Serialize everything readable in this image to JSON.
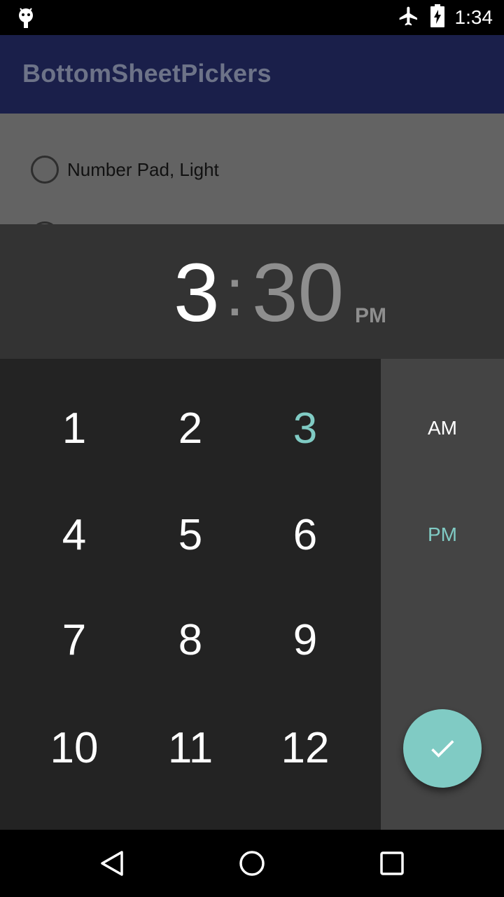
{
  "status_bar": {
    "time": "1:34",
    "icons": [
      "android-debug-icon",
      "airplane-mode-icon",
      "battery-charging-icon"
    ]
  },
  "app_bar": {
    "title": "BottomSheetPickers"
  },
  "options": [
    {
      "label": "Number Pad, Light",
      "selected": false
    }
  ],
  "picker": {
    "hour": "3",
    "colon": ":",
    "minute": "30",
    "ampm": "PM",
    "keys": [
      "1",
      "2",
      "3",
      "4",
      "5",
      "6",
      "7",
      "8",
      "9",
      "10",
      "11",
      "12"
    ],
    "highlighted_key": "3",
    "am_label": "AM",
    "pm_label": "PM",
    "selected_period": "PM",
    "confirm_icon": "check-icon"
  },
  "colors": {
    "accent": "#80cbc4",
    "app_bar": "#1a1f4a",
    "header_bg": "#333333",
    "pad_bg": "#232323",
    "side_panel_bg": "#444444"
  },
  "nav_bar": {
    "icons": [
      "back-icon",
      "home-icon",
      "recents-icon"
    ]
  }
}
